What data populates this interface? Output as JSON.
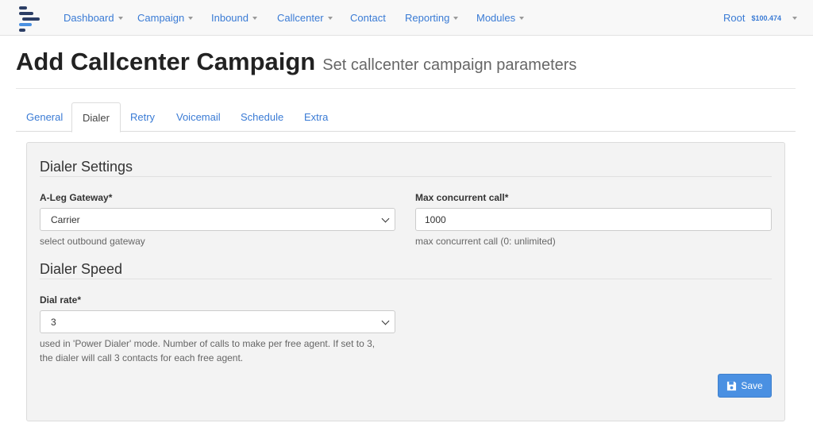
{
  "nav": {
    "items": [
      {
        "label": "Dashboard",
        "caret": true
      },
      {
        "label": "Campaign",
        "caret": true
      },
      {
        "label": "Inbound",
        "caret": true
      },
      {
        "label": "Callcenter",
        "caret": true
      },
      {
        "label": "Contact",
        "caret": false
      },
      {
        "label": "Reporting",
        "caret": true
      },
      {
        "label": "Modules",
        "caret": true
      }
    ],
    "user": {
      "name": "Root",
      "balance": "$100.474"
    }
  },
  "header": {
    "title": "Add Callcenter Campaign",
    "subtitle": "Set callcenter campaign parameters"
  },
  "tabs": [
    {
      "label": "General",
      "active": false
    },
    {
      "label": "Dialer",
      "active": true
    },
    {
      "label": "Retry",
      "active": false
    },
    {
      "label": "Voicemail",
      "active": false
    },
    {
      "label": "Schedule",
      "active": false
    },
    {
      "label": "Extra",
      "active": false
    }
  ],
  "form": {
    "dialer_settings": {
      "title": "Dialer Settings",
      "gateway": {
        "label": "A-Leg Gateway*",
        "value": "Carrier",
        "help": "select outbound gateway"
      },
      "max_calls": {
        "label": "Max concurrent call*",
        "value": "1000",
        "help": "max concurrent call (0: unlimited)"
      }
    },
    "dialer_speed": {
      "title": "Dialer Speed",
      "dial_rate": {
        "label": "Dial rate*",
        "value": "3",
        "help_line1": "used in 'Power Dialer' mode. Number of calls to make per free agent. If set to 3,",
        "help_line2": "the dialer will call 3 contacts for each free agent."
      }
    },
    "save_label": "Save"
  },
  "colors": {
    "link": "#3a7bd5",
    "button": "#4a90e2",
    "panel": "#f3f3f3"
  }
}
